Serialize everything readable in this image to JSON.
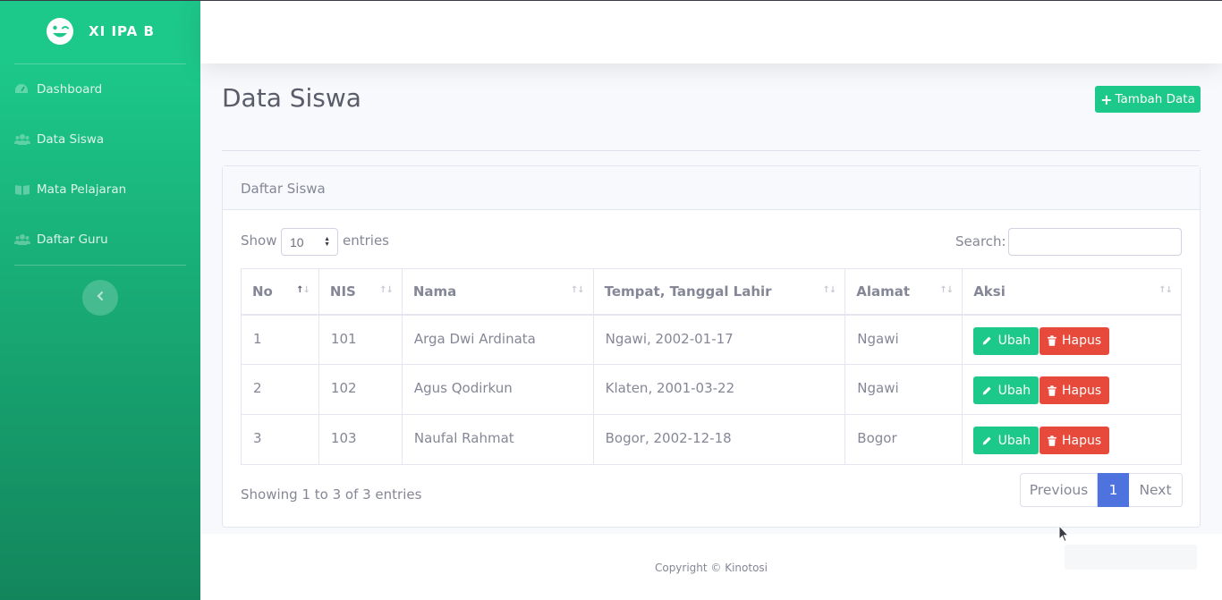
{
  "sidebar": {
    "brand": "XI IPA B",
    "brand_icon": "laugh-wink-icon",
    "items": [
      {
        "label": "Dashboard",
        "icon": "tachometer-icon"
      },
      {
        "label": "Data Siswa",
        "icon": "users-icon"
      },
      {
        "label": "Mata Pelajaran",
        "icon": "book-open-icon"
      },
      {
        "label": "Daftar Guru",
        "icon": "users-icon"
      }
    ],
    "toggle_icon": "chevron-left-icon"
  },
  "page": {
    "title": "Data Siswa",
    "add_button": "Tambah Data"
  },
  "card": {
    "title": "Daftar Siswa",
    "show_label": "Show",
    "entries_value": "10",
    "entries_label": "entries",
    "search_label": "Search:",
    "search_value": "",
    "columns": [
      "No",
      "NIS",
      "Nama",
      "Tempat, Tanggal Lahir",
      "Alamat",
      "Aksi"
    ],
    "rows": [
      {
        "no": "1",
        "nis": "101",
        "nama": "Arga Dwi Ardinata",
        "ttl": "Ngawi, 2002-01-17",
        "alamat": "Ngawi"
      },
      {
        "no": "2",
        "nis": "102",
        "nama": "Agus Qodirkun",
        "ttl": "Klaten, 2001-03-22",
        "alamat": "Ngawi"
      },
      {
        "no": "3",
        "nis": "103",
        "nama": "Naufal Rahmat",
        "ttl": "Bogor, 2002-12-18",
        "alamat": "Bogor"
      }
    ],
    "edit_label": "Ubah",
    "delete_label": "Hapus",
    "info": "Showing 1 to 3 of 3 entries",
    "pagination": {
      "previous": "Previous",
      "current": "1",
      "next": "Next"
    }
  },
  "footer": {
    "copyright": "Copyright © Kinotosi"
  },
  "colors": {
    "primary": "#4e73df",
    "success": "#1cc88a",
    "danger": "#e74a3b"
  }
}
